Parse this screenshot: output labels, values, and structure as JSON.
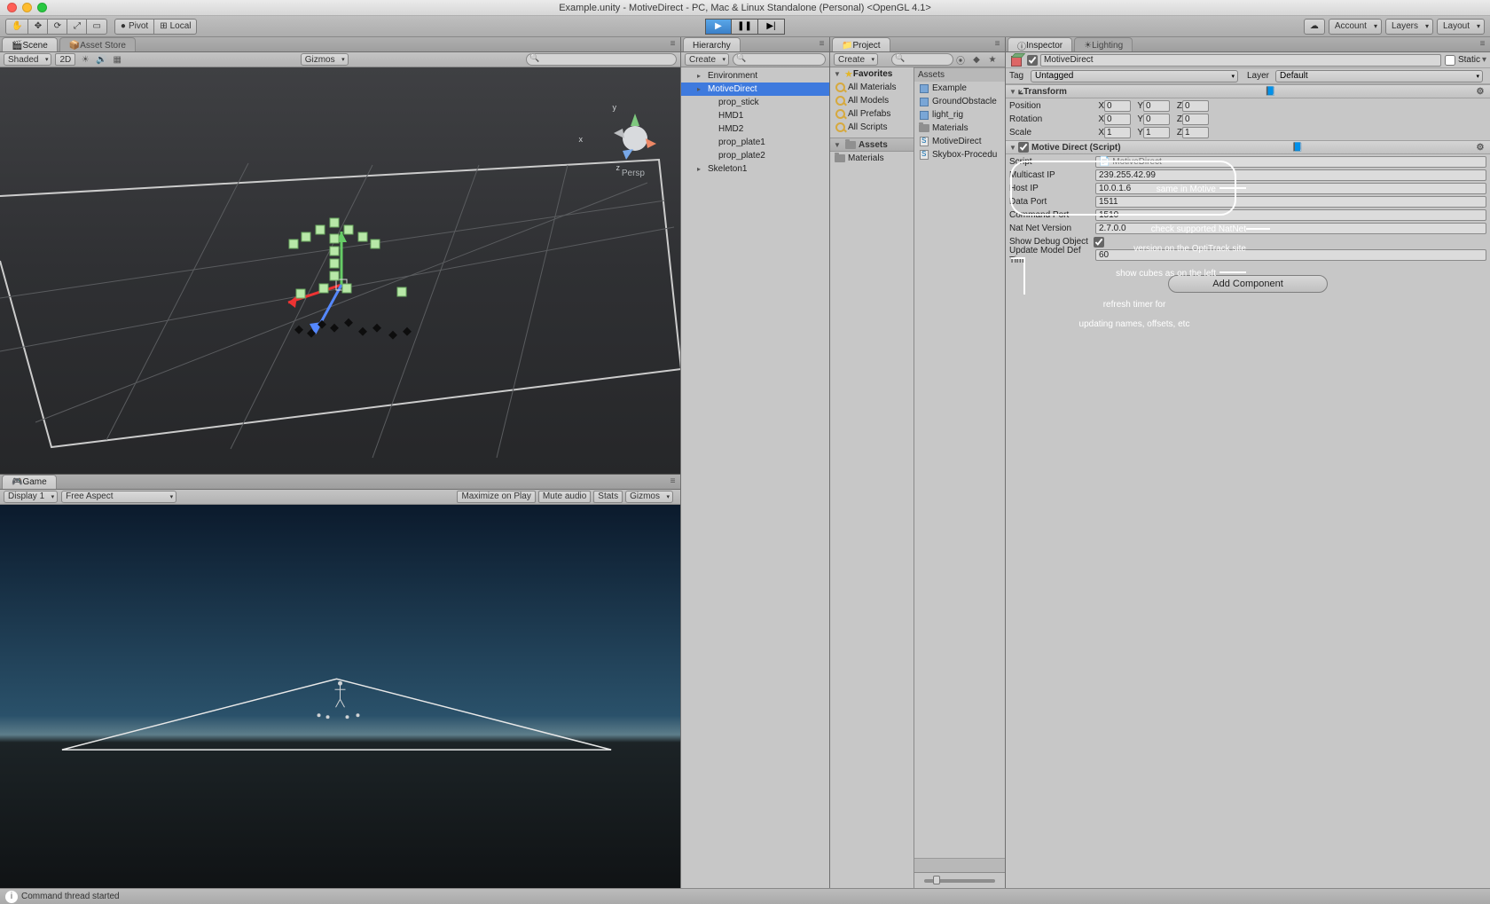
{
  "window_title": "Example.unity - MotiveDirect - PC, Mac & Linux Standalone (Personal) <OpenGL 4.1>",
  "toolbar": {
    "pivot": "Pivot",
    "local": "Local",
    "account": "Account",
    "layers": "Layers",
    "layout": "Layout"
  },
  "scene": {
    "tab": "Scene",
    "tab2": "Asset Store",
    "shading": "Shaded",
    "mode_2d": "2D",
    "gizmos": "Gizmos",
    "persp": "Persp",
    "axes": {
      "x": "x",
      "y": "y",
      "z": "z"
    }
  },
  "game": {
    "tab": "Game",
    "display": "Display 1",
    "aspect": "Free Aspect",
    "maximize": "Maximize on Play",
    "mute": "Mute audio",
    "stats": "Stats",
    "gizmos": "Gizmos"
  },
  "hierarchy": {
    "tab": "Hierarchy",
    "create": "Create",
    "items": [
      {
        "label": "Environment",
        "expand": true,
        "indent": 0
      },
      {
        "label": "MotiveDirect",
        "expand": true,
        "indent": 0,
        "selected": true
      },
      {
        "label": "prop_stick",
        "indent": 1
      },
      {
        "label": "HMD1",
        "indent": 1
      },
      {
        "label": "HMD2",
        "indent": 1
      },
      {
        "label": "prop_plate1",
        "indent": 1
      },
      {
        "label": "prop_plate2",
        "indent": 1
      },
      {
        "label": "Skeleton1",
        "expand": true,
        "indent": 0
      }
    ]
  },
  "project": {
    "tab": "Project",
    "create": "Create",
    "favorites": "Favorites",
    "fav_items": [
      "All Materials",
      "All Models",
      "All Prefabs",
      "All Scripts"
    ],
    "assets": "Assets",
    "asset_items": [
      "Materials"
    ],
    "right_header": "Assets",
    "right_items": [
      {
        "label": "Example",
        "icon": "cube"
      },
      {
        "label": "GroundObstacle",
        "icon": "cube"
      },
      {
        "label": "light_rig",
        "icon": "cube"
      },
      {
        "label": "Materials",
        "icon": "folder"
      },
      {
        "label": "MotiveDirect",
        "icon": "script"
      },
      {
        "label": "Skybox-Procedu",
        "icon": "script"
      }
    ]
  },
  "inspector": {
    "tab": "Inspector",
    "tab2": "Lighting",
    "object_name": "MotiveDirect",
    "static": "Static",
    "tag_label": "Tag",
    "tag_value": "Untagged",
    "layer_label": "Layer",
    "layer_value": "Default",
    "transform": {
      "title": "Transform",
      "position": "Position",
      "rotation": "Rotation",
      "scale": "Scale",
      "pos": {
        "x": "0",
        "y": "0",
        "z": "0"
      },
      "rot": {
        "x": "0",
        "y": "0",
        "z": "0"
      },
      "scl": {
        "x": "1",
        "y": "1",
        "z": "1"
      }
    },
    "script": {
      "title": "Motive Direct (Script)",
      "script_label": "Script",
      "script_name": "MotiveDirect",
      "fields": [
        {
          "label": "Multicast IP",
          "value": "239.255.42.99"
        },
        {
          "label": "Host IP",
          "value": "10.0.1.6"
        },
        {
          "label": "Data Port",
          "value": "1511"
        },
        {
          "label": "Command Port",
          "value": "1510"
        },
        {
          "label": "Nat Net Version",
          "value": "2.7.0.0"
        },
        {
          "label": "Show Debug Object",
          "value": "",
          "checkbox": true,
          "checked": true
        },
        {
          "label": "Update Model Def Tim",
          "value": "60"
        }
      ]
    },
    "add_component": "Add Component"
  },
  "annotations": {
    "a1": "same in Motive",
    "a2_l1": "check supported NatNet",
    "a2_l2": "version on the OptiTrack site",
    "a3": "show cubes as on the left",
    "a4_l1": "refresh timer for",
    "a4_l2": "updating names, offsets, etc"
  },
  "status": "Command thread started"
}
